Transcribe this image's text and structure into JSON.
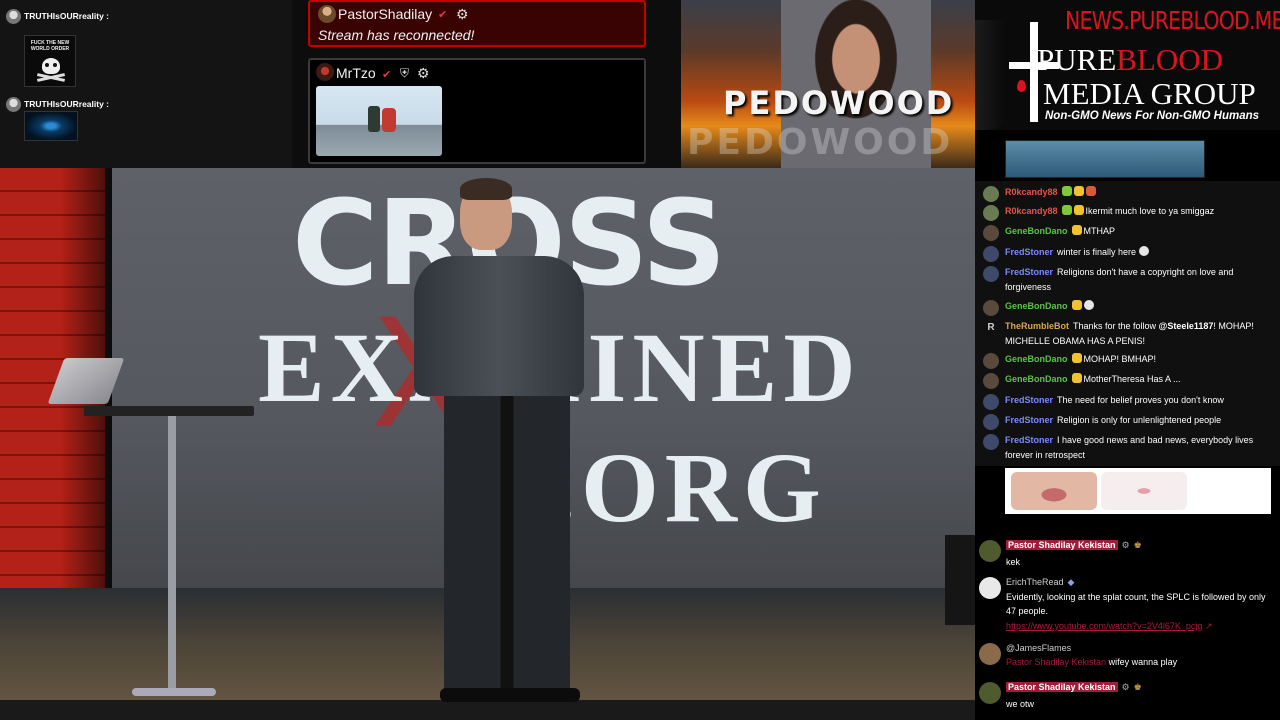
{
  "top_left_chat": {
    "messages": [
      {
        "user": "TRUTHIsOURreality :",
        "image_caption": "FUCK THE NEW WORLD ORDER"
      },
      {
        "user": "TRUTHIsOURreality :"
      }
    ]
  },
  "alerts": {
    "reconnect": {
      "user": "PastorShadilay",
      "verified_icon": "check-icon",
      "gear_icon": "gear-icon",
      "message": "Stream has reconnected!"
    },
    "media": {
      "user": "MrTzo",
      "verified_icon": "check-icon",
      "shield_icon": "shield-icon",
      "gear_icon": "gear-icon"
    }
  },
  "promo": {
    "text": "PEDOWOOD",
    "text_shadow": "PEDOWOOD"
  },
  "logo": {
    "site": "NEWS.PUREBLOOD.MEDIA",
    "line1_a": "P",
    "line1_b": "URE",
    "line1_c": "BLOOD",
    "line2": "MEDIA GROUP",
    "tagline": "Non-GMO News For Non-GMO Humans",
    "colors": {
      "accent": "#d7141f"
    }
  },
  "video": {
    "screen_line1": "CROSS",
    "screen_line2": "EXAMINED",
    "screen_x": "X",
    "screen_line3": ".ORG"
  },
  "chat": {
    "messages": [
      {
        "user": "R0kcandy88",
        "color": "#e0574a",
        "text": ""
      },
      {
        "user": "R0kcandy88",
        "color": "#e0574a",
        "text": "Ikermit much love to ya smiggaz"
      },
      {
        "user": "GeneBonDano",
        "color": "#5bc24a",
        "text": "MTHAP"
      },
      {
        "user": "FredStoner",
        "color": "#7a8cff",
        "text": "winter is finally here"
      },
      {
        "user": "FredStoner",
        "color": "#7a8cff",
        "text": "Religions don't have a copyright on love and forgiveness"
      },
      {
        "user": "GeneBonDano",
        "color": "#5bc24a",
        "text": ""
      },
      {
        "user": "TheRumbleBot",
        "color": "#d9a64a",
        "text": "Thanks for the follow ",
        "mention": "@Steele1187",
        "text2": "! MOHAP! MICHELLE OBAMA HAS A PENIS!"
      },
      {
        "user": "GeneBonDano",
        "color": "#5bc24a",
        "text": "MOHAP! BMHAP!"
      },
      {
        "user": "GeneBonDano",
        "color": "#5bc24a",
        "text": "MotherTheresa Has A ..."
      },
      {
        "user": "FredStoner",
        "color": "#7a8cff",
        "text": "The need for belief proves you don't know"
      },
      {
        "user": "FredStoner",
        "color": "#7a8cff",
        "text": "Religion is only for unlenlightened people"
      },
      {
        "user": "FredStoner",
        "color": "#7a8cff",
        "text": "I have good news and bad news, everybody lives forever in retrospect"
      }
    ],
    "bot_badge": "R"
  },
  "chat2": {
    "messages": [
      {
        "user": "Pastor Shadilay Kekistan",
        "text": "kek"
      },
      {
        "user": "ErichTheRead",
        "text": "Evidently, looking at the splat count, the SPLC is followed by only 47 people.",
        "link": "https://www.youtube.com/watch?v=2V4l67K_pcjg"
      },
      {
        "user": "@JamesFlames",
        "reply_to": "Pastor Shadilay Kekistan",
        "text": "wifey wanna play"
      },
      {
        "user": "Pastor Shadilay Kekistan",
        "text": "we otw"
      }
    ]
  }
}
